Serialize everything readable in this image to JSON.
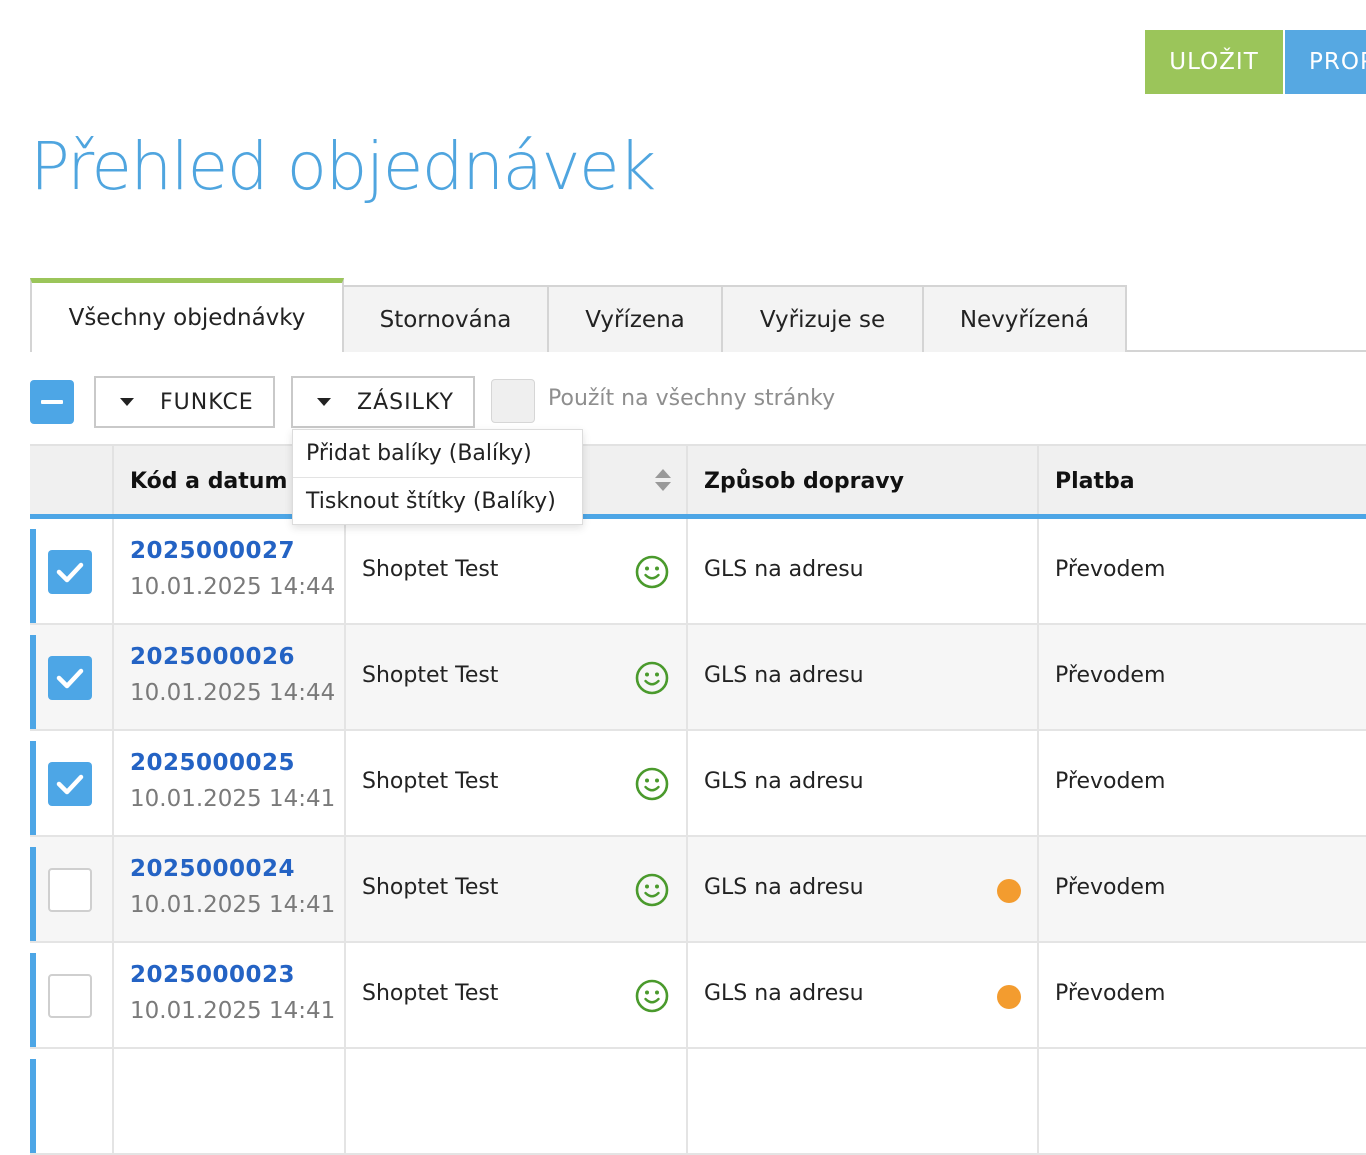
{
  "header": {
    "save_label": "ULOŽIT",
    "next_label": "PROPOJIT"
  },
  "page": {
    "title": "Přehled objednávek"
  },
  "tabs": [
    {
      "label": "Všechny objednávky",
      "active": true
    },
    {
      "label": "Stornována"
    },
    {
      "label": "Vyřízena"
    },
    {
      "label": "Vyřizuje se"
    },
    {
      "label": "Nevyřízená"
    }
  ],
  "toolbar": {
    "functions_label": "FUNKCE",
    "shipments_label": "ZÁSILKY",
    "apply_all_label": "Použít na všechny stránky"
  },
  "shipments_menu": [
    {
      "label": "Přidat balíky (Balíky)"
    },
    {
      "label": "Tisknout štítky (Balíky)"
    }
  ],
  "table": {
    "columns": {
      "code_date": "Kód a datum",
      "shipping": "Způsob dopravy",
      "payment": "Platba"
    },
    "rows": [
      {
        "code": "2025000027",
        "date": "10.01.2025 14:44",
        "customer": "Shoptet Test",
        "shipping": "GLS na adresu",
        "payment": "Převodem",
        "checked": true,
        "flag": false
      },
      {
        "code": "2025000026",
        "date": "10.01.2025 14:44",
        "customer": "Shoptet Test",
        "shipping": "GLS na adresu",
        "payment": "Převodem",
        "checked": true,
        "flag": false
      },
      {
        "code": "2025000025",
        "date": "10.01.2025 14:41",
        "customer": "Shoptet Test",
        "shipping": "GLS na adresu",
        "payment": "Převodem",
        "checked": true,
        "flag": false
      },
      {
        "code": "2025000024",
        "date": "10.01.2025 14:41",
        "customer": "Shoptet Test",
        "shipping": "GLS na adresu",
        "payment": "Převodem",
        "checked": false,
        "flag": true
      },
      {
        "code": "2025000023",
        "date": "10.01.2025 14:41",
        "customer": "Shoptet Test",
        "shipping": "GLS na adresu",
        "payment": "Převodem",
        "checked": false,
        "flag": true
      }
    ]
  },
  "colors": {
    "accent_blue": "#4da6e6",
    "save_green": "#9bc55a",
    "smile_green": "#4a9a2c",
    "flag_orange": "#f39c2f",
    "link_blue": "#2463c4"
  }
}
